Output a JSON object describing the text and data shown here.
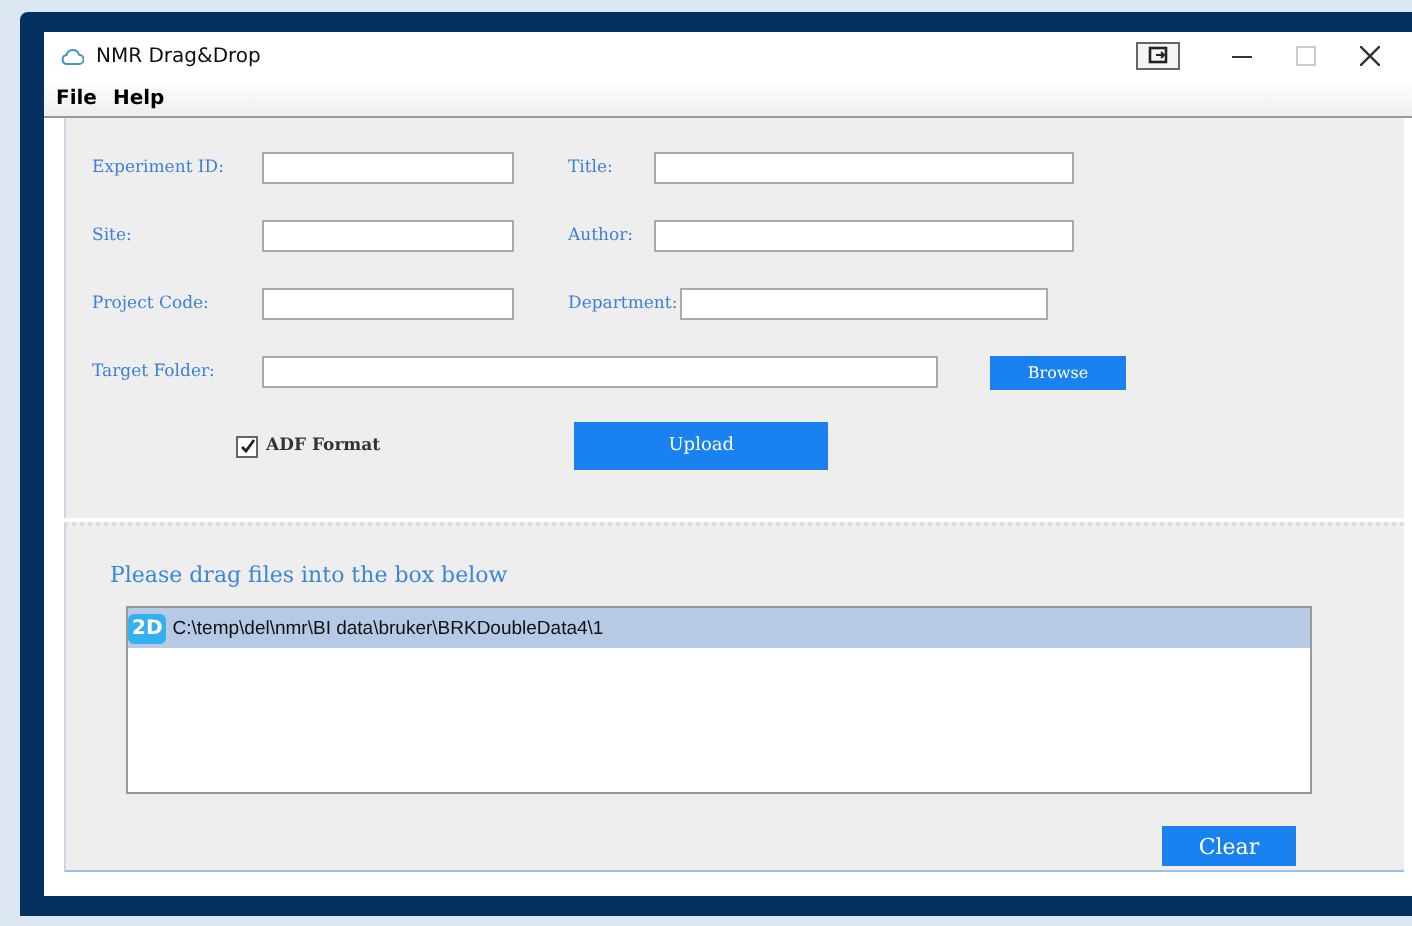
{
  "window": {
    "title": "NMR Drag&Drop"
  },
  "menu": [
    "File",
    "Help"
  ],
  "fields": [
    {
      "label": "Experiment ID:"
    },
    {
      "label": "Title:"
    },
    {
      "label": "Site:"
    },
    {
      "label": "Author:"
    },
    {
      "label": "Project Code:"
    },
    {
      "label": "Department:"
    }
  ],
  "target_folder": {
    "label": "Target Folder:",
    "button": "Browse"
  },
  "adf_format": {
    "label": "ADF Format",
    "checked": true
  },
  "upload_button": "Upload",
  "drop_area": {
    "heading": "Please drag files into the box below",
    "files": [
      {
        "badge": "2D",
        "path": "C:\\temp\\del\\nmr\\BI data\\bruker\\BRKDoubleData4\\1",
        "selected": true
      }
    ]
  },
  "clear_button": "Clear"
}
